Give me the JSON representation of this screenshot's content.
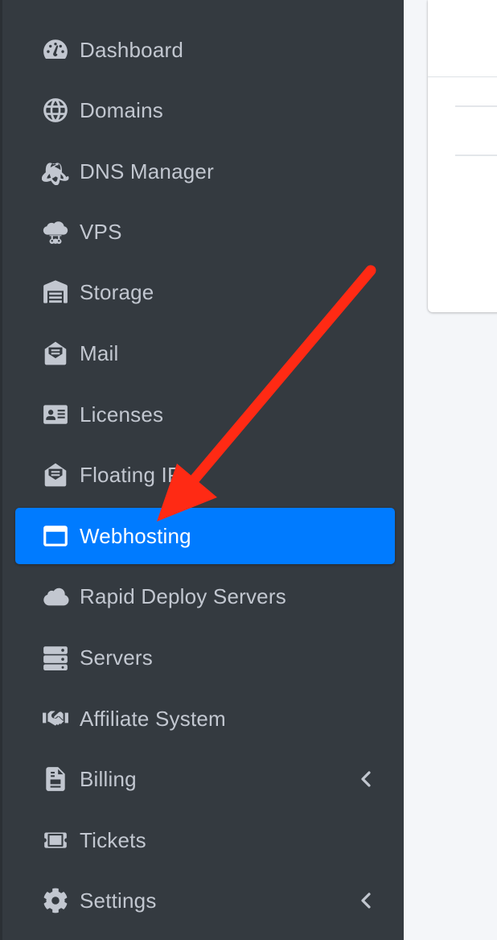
{
  "sidebar": {
    "items": [
      {
        "label": "Dashboard",
        "icon": "tachometer-icon",
        "active": false,
        "has_chevron": false
      },
      {
        "label": "Domains",
        "icon": "globe-icon",
        "active": false,
        "has_chevron": false
      },
      {
        "label": "DNS Manager",
        "icon": "atom-icon",
        "active": false,
        "has_chevron": false
      },
      {
        "label": "VPS",
        "icon": "cloud-network-icon",
        "active": false,
        "has_chevron": false
      },
      {
        "label": "Storage",
        "icon": "warehouse-icon",
        "active": false,
        "has_chevron": false
      },
      {
        "label": "Mail",
        "icon": "envelope-open-icon",
        "active": false,
        "has_chevron": false
      },
      {
        "label": "Licenses",
        "icon": "id-card-icon",
        "active": false,
        "has_chevron": false
      },
      {
        "label": "Floating IP",
        "icon": "envelope-open-text-icon",
        "active": false,
        "has_chevron": false
      },
      {
        "label": "Webhosting",
        "icon": "window-icon",
        "active": true,
        "has_chevron": false
      },
      {
        "label": "Rapid Deploy Servers",
        "icon": "cloud-icon",
        "active": false,
        "has_chevron": false
      },
      {
        "label": "Servers",
        "icon": "server-icon",
        "active": false,
        "has_chevron": false
      },
      {
        "label": "Affiliate System",
        "icon": "handshake-icon",
        "active": false,
        "has_chevron": false
      },
      {
        "label": "Billing",
        "icon": "file-invoice-icon",
        "active": false,
        "has_chevron": true
      },
      {
        "label": "Tickets",
        "icon": "ticket-icon",
        "active": false,
        "has_chevron": false
      },
      {
        "label": "Settings",
        "icon": "gear-icon",
        "active": false,
        "has_chevron": true
      }
    ]
  },
  "colors": {
    "sidebar_bg": "#343a40",
    "text": "#c2c7d0",
    "active_bg": "#007bff",
    "active_text": "#ffffff",
    "annotation_arrow": "#ff2a14"
  }
}
